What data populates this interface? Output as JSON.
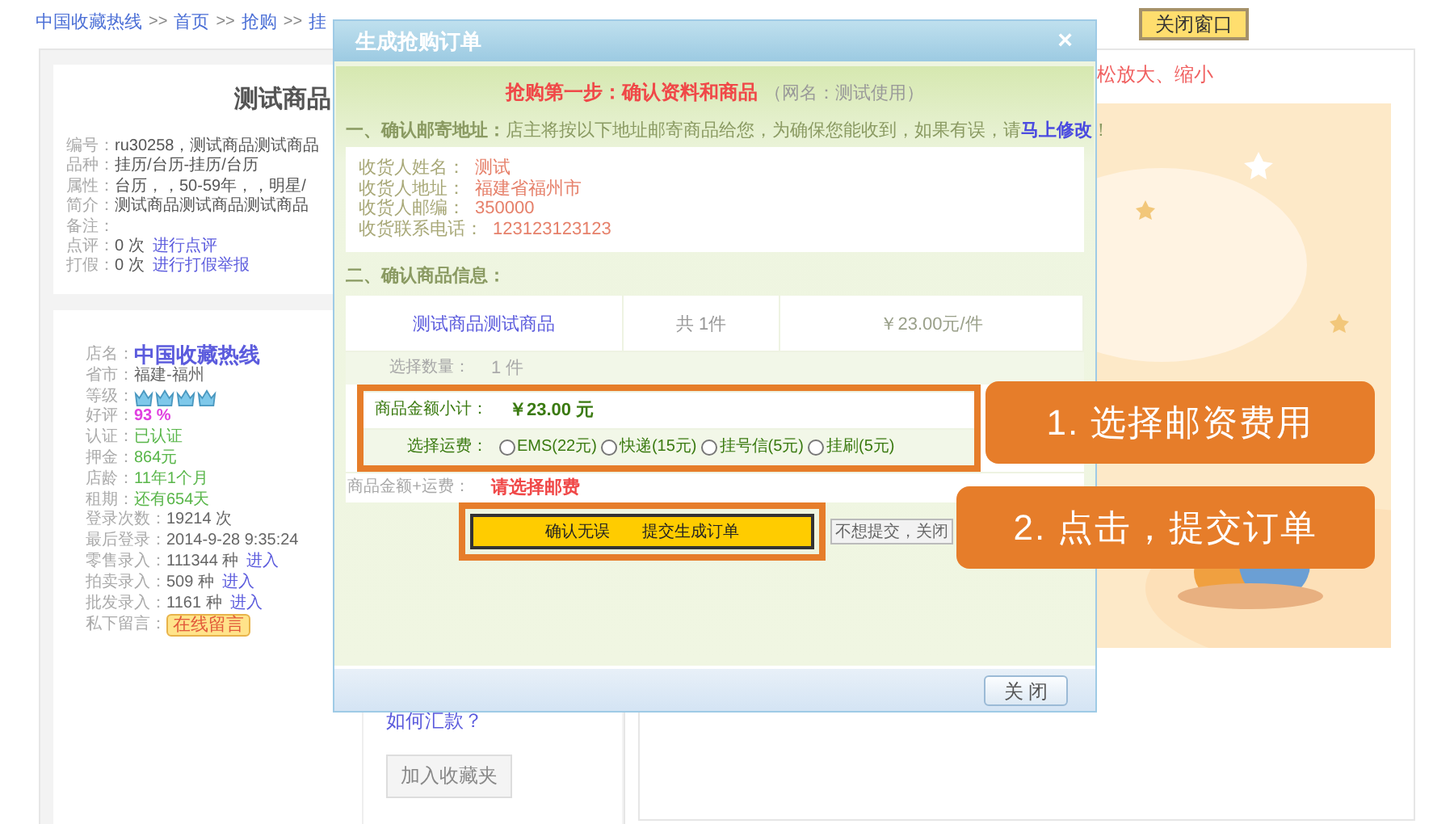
{
  "breadcrumb": [
    {
      "kind": "link",
      "text": "中国收藏热线"
    },
    {
      "kind": "sep",
      "text": ">>"
    },
    {
      "kind": "link",
      "text": "首页"
    },
    {
      "kind": "sep",
      "text": ">>"
    },
    {
      "kind": "link",
      "text": "抢购"
    },
    {
      "kind": "sep",
      "text": ">>"
    },
    {
      "kind": "link",
      "text": "挂"
    }
  ],
  "close_window_button": "关闭窗口",
  "product": {
    "title": "测试商品",
    "fields": [
      {
        "label": "编号：",
        "value": "ru30258，测试商品测试商品"
      },
      {
        "label": "品种：",
        "value": "挂历/台历-挂历/台历"
      },
      {
        "label": "属性：",
        "value": "台历，，50-59年，，明星/"
      },
      {
        "label": "简介：",
        "value": "测试商品测试商品测试商品"
      },
      {
        "label": "备注："
      },
      {
        "label": "点评：",
        "value": "0 次",
        "link": "进行点评"
      },
      {
        "label": "打假：",
        "value": "0 次",
        "link": "进行打假举报"
      }
    ]
  },
  "shop": {
    "fields": [
      {
        "label": "店名：",
        "value": "中国收藏热线",
        "kind": "name"
      },
      {
        "label": "省市：",
        "value": "福建-福州",
        "kind": "plain"
      },
      {
        "label": "等级：",
        "stars": 4,
        "kind": "rank"
      },
      {
        "label": "好评：",
        "value": "93 %",
        "kind": "pink"
      },
      {
        "label": "认证：",
        "value": "已认证",
        "kind": "green"
      },
      {
        "label": "押金：",
        "value": "864元",
        "kind": "green"
      },
      {
        "label": "店龄：",
        "value": "11年1个月",
        "kind": "green"
      },
      {
        "label": "租期：",
        "value": "还有654天",
        "kind": "green"
      },
      {
        "label": "登录次数：",
        "value": "19214 次",
        "kind": "plain"
      },
      {
        "label": "最后登录：",
        "value": "2014-9-28 9:35:24",
        "kind": "plain"
      },
      {
        "label": "零售录入：",
        "value": "111344 种",
        "link": "进入",
        "kind": "plain"
      },
      {
        "label": "拍卖录入：",
        "value": "509 种",
        "link": "进入",
        "kind": "plain"
      },
      {
        "label": "批发录入：",
        "value": "1161 种",
        "link": "进入",
        "kind": "plain"
      },
      {
        "label": "私下留言：",
        "button": "在线留言",
        "kind": "message"
      }
    ],
    "how_to_pay": "如何汇款？",
    "favorite_button": "加入收藏夹"
  },
  "zoom_hint": "松放大、缩小",
  "dialog": {
    "title": "生成抢购订单",
    "close": "×",
    "step": {
      "title": "抢购第一步：确认资料和商品",
      "note": "（网名：测试使用）"
    },
    "address_heading": {
      "title": "一、确认邮寄地址：",
      "text": "店主将按以下地址邮寄商品给您，为确保您能收到，如果有误，请",
      "link": "马上修改",
      "end": "！"
    },
    "address": [
      {
        "label": "收货人姓名：",
        "value": "测试"
      },
      {
        "label": "收货人地址：",
        "value": "福建省福州市"
      },
      {
        "label": "收货人邮编：",
        "value": "350000"
      },
      {
        "label": "收货联系电话：",
        "value": "123123123123"
      }
    ],
    "goods_heading": "二、确认商品信息：",
    "goods": {
      "name": "测试商品测试商品",
      "count": "共 1件",
      "price": "￥23.00元/件"
    },
    "quantity": {
      "label": "选择数量：",
      "value": "1 件"
    },
    "subtotal": {
      "label": "商品金额小计：",
      "value": "￥23.00 元"
    },
    "shipping": {
      "label": "选择运费：",
      "options": [
        {
          "label": "EMS(22元)",
          "selected": false
        },
        {
          "label": "快递(15元)",
          "selected": false
        },
        {
          "label": "挂号信(5元)",
          "selected": false
        },
        {
          "label": "挂刷(5元)",
          "selected": false
        }
      ]
    },
    "total": {
      "label": "商品金额+运费：",
      "value": "请选择邮费"
    },
    "submit_button": "确认无误　　提交生成订单",
    "cancel_button": "不想提交，关闭",
    "footer_close": "关 闭"
  },
  "callouts": [
    "1. 选择邮资费用",
    "2. 点击，提交订单"
  ]
}
